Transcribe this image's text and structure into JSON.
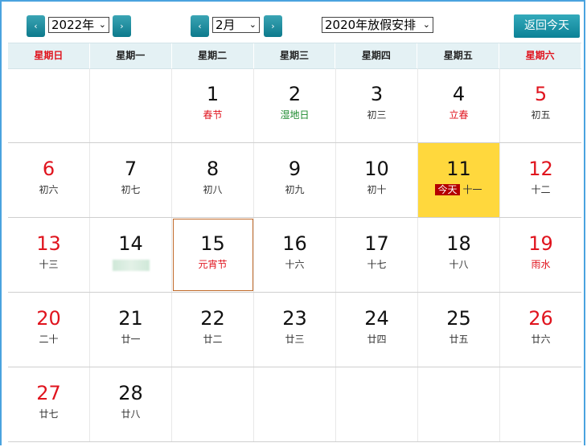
{
  "toolbar": {
    "prev_year_icon": "chevron-left",
    "year_value": "2022年",
    "next_year_icon": "chevron-right",
    "prev_month_icon": "chevron-left",
    "month_value": "2月",
    "next_month_icon": "chevron-right",
    "holiday_value": "2020年放假安排",
    "today_button": "返回今天",
    "glyph_prev": "‹",
    "glyph_next": "›",
    "glyph_dropdown": "⌄"
  },
  "weekdays": [
    "星期日",
    "星期一",
    "星期二",
    "星期三",
    "星期四",
    "星期五",
    "星期六"
  ],
  "today_badge": "今天",
  "weeks": [
    [
      {
        "day": "",
        "lunar": ""
      },
      {
        "day": "",
        "lunar": ""
      },
      {
        "day": "1",
        "lunar": "春节",
        "lunar_color": "red"
      },
      {
        "day": "2",
        "lunar": "湿地日",
        "lunar_color": "green"
      },
      {
        "day": "3",
        "lunar": "初三"
      },
      {
        "day": "4",
        "lunar": "立春",
        "lunar_color": "red"
      },
      {
        "day": "5",
        "lunar": "初五",
        "day_color": "red"
      }
    ],
    [
      {
        "day": "6",
        "lunar": "初六",
        "day_color": "red"
      },
      {
        "day": "7",
        "lunar": "初七"
      },
      {
        "day": "8",
        "lunar": "初八"
      },
      {
        "day": "9",
        "lunar": "初九"
      },
      {
        "day": "10",
        "lunar": "初十"
      },
      {
        "day": "11",
        "lunar": "十一",
        "today": true
      },
      {
        "day": "12",
        "lunar": "十二",
        "day_color": "red"
      }
    ],
    [
      {
        "day": "13",
        "lunar": "十三",
        "day_color": "red"
      },
      {
        "day": "14",
        "lunar": "",
        "blurred": true
      },
      {
        "day": "15",
        "lunar": "元宵节",
        "lunar_color": "red",
        "selected": true
      },
      {
        "day": "16",
        "lunar": "十六"
      },
      {
        "day": "17",
        "lunar": "十七"
      },
      {
        "day": "18",
        "lunar": "十八"
      },
      {
        "day": "19",
        "lunar": "雨水",
        "day_color": "red",
        "lunar_color": "red"
      }
    ],
    [
      {
        "day": "20",
        "lunar": "二十",
        "day_color": "red"
      },
      {
        "day": "21",
        "lunar": "廿一"
      },
      {
        "day": "22",
        "lunar": "廿二"
      },
      {
        "day": "23",
        "lunar": "廿三"
      },
      {
        "day": "24",
        "lunar": "廿四"
      },
      {
        "day": "25",
        "lunar": "廿五"
      },
      {
        "day": "26",
        "lunar": "廿六",
        "day_color": "red"
      }
    ],
    [
      {
        "day": "27",
        "lunar": "廿七",
        "day_color": "red"
      },
      {
        "day": "28",
        "lunar": "廿八"
      },
      {
        "day": "",
        "lunar": ""
      },
      {
        "day": "",
        "lunar": ""
      },
      {
        "day": "",
        "lunar": ""
      },
      {
        "day": "",
        "lunar": ""
      },
      {
        "day": "",
        "lunar": ""
      }
    ]
  ]
}
